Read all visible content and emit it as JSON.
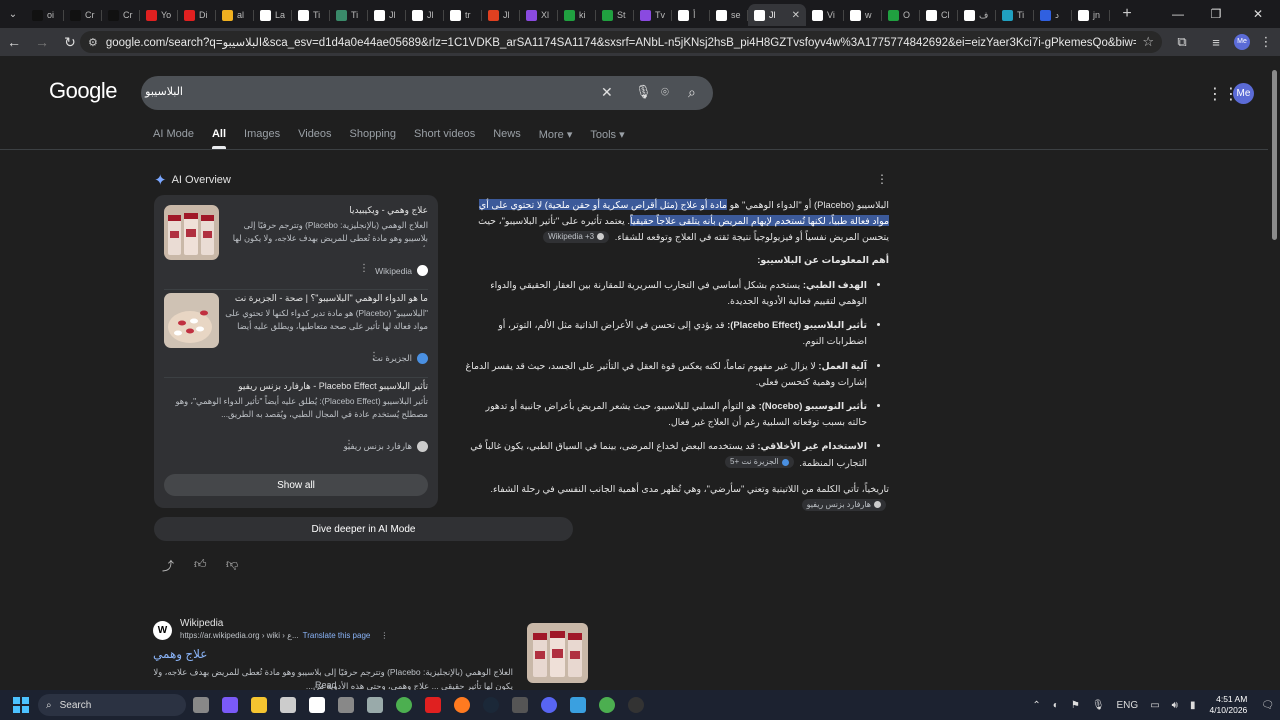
{
  "browser": {
    "tabs": [
      {
        "label": "oi",
        "color": "#111"
      },
      {
        "label": "Cr",
        "color": "#111"
      },
      {
        "label": "Cr",
        "color": "#111"
      },
      {
        "label": "Yo",
        "color": "#e02020"
      },
      {
        "label": "Di",
        "color": "#e02020"
      },
      {
        "label": "al",
        "color": "#f0b020"
      },
      {
        "label": "La",
        "color": "#ffffff"
      },
      {
        "label": "Ti",
        "color": "#ffffff"
      },
      {
        "label": "Ti",
        "color": "#3a8a6a"
      },
      {
        "label": "Jl",
        "color": "#ffffff"
      },
      {
        "label": "Jl",
        "color": "#ffffff"
      },
      {
        "label": "tr",
        "color": "#ffffff"
      },
      {
        "label": "Jl",
        "color": "#e04020"
      },
      {
        "label": "Xl",
        "color": "#8a4ae0"
      },
      {
        "label": "ki",
        "color": "#20a040"
      },
      {
        "label": "St",
        "color": "#20a040"
      },
      {
        "label": "Tv",
        "color": "#8a4ae0"
      },
      {
        "label": "أ",
        "color": "#ffffff"
      },
      {
        "label": "se",
        "color": "#ffffff"
      },
      {
        "label": "Jl",
        "color": "#ffffff",
        "active": true
      },
      {
        "label": "Vi",
        "color": "#ffffff"
      },
      {
        "label": "w",
        "color": "#ffffff"
      },
      {
        "label": "O",
        "color": "#20a040"
      },
      {
        "label": "Cl",
        "color": "#ffffff"
      },
      {
        "label": "ف",
        "color": "#ffffff"
      },
      {
        "label": "Ti",
        "color": "#20a0c0"
      },
      {
        "label": "د",
        "color": "#3060e0"
      },
      {
        "label": "jn",
        "color": "#ffffff"
      }
    ],
    "tab_close": "✕",
    "new_tab": "+",
    "url": "google.com/search?q=البلاسيبو&sca_esv=d1d4a0e44ae05689&rlz=1C1VDKB_arSA1174SA1174&sxsrf=ANbL-n5jKNsj2hsB_pi4H8GZTvsfoyv4w%3A1775774842692&ei=eizYaer3Kci7i-gPkemesQo&biw=1920&bih=945&oq=البلاسيب&gs_lp=Egwnd3Mt..."
  },
  "google": {
    "logo": "Google",
    "query": "البلاسيبو",
    "tabs": [
      "AI Mode",
      "All",
      "Images",
      "Videos",
      "Shopping",
      "Short videos",
      "News",
      "More ▾",
      "Tools ▾"
    ],
    "selected_tab": "All",
    "avatar": "Me"
  },
  "ai_overview": {
    "title": "AI Overview",
    "sources": [
      {
        "title": "علاج وهمي - ويكيبيديا",
        "snippet": "العلاج الوهمي (بالإنجليزية: Placebo) وتترجم حرفيًا إلى بلاسيبو وهو مادة تُعطى للمريض بهدف علاجه، ولا يكون لها تأثير حقيقي ف...",
        "site": "Wikipedia",
        "fav_color": "#ffffff"
      },
      {
        "title": "ما هو الدواء الوهمي \"البلاسيبو\"؟ | صحة - الجزيرة نت",
        "snippet": "\"البلاسيبو\" (Placebo) هو مادة تدير كدواء لكنها لا تحتوي على مواد فعالة لها تأثير على صحة متعاطيها، ويطلق عليه أيضا اسم...",
        "site": "الجزيرة نت",
        "fav_color": "#4a90e2"
      },
      {
        "title": "تأثير البلاسيبو Placebo Effect - هارفارد بزنس ريفيو",
        "snippet": "تأثير البلاسيبو (Placebo Effect): يُطلق عليه أيضاً \"تأثير الدواء الوهمي\"، وهو مصطلح يُستخدم عادة في المجال الطبي، ويُقصد به الطريق...",
        "site": "هارفارد بزنس ريفيو",
        "fav_color": "#cccccc"
      }
    ],
    "show_all": "Show all",
    "para1_a": "البلاسيبو (Placebo) أو \"الدواء الوهمي\" هو ",
    "para1_hl": "مادة أو علاج (مثل أقراص سكرية أو حقن ملحية) لا تحتوي على أي مواد فعالة طبياً، لكنها تُستخدم لإيهام المريض بأنه يتلقى علاجاً حقيقياً",
    "para1_b": ". يعتمد تأثيره على \"تأثير البلاسيبو\"، حيث يتحسن المريض نفسياً أو فيزيولوجياً نتيجة ثقته في العلاج وتوقعه للشفاء.",
    "para1_chip": "Wikipedia +3",
    "heading": "أهم المعلومات عن البلاسيبو:",
    "bullets": [
      {
        "bold": "الهدف الطبي:",
        "text": " يستخدم بشكل أساسي في التجارب السريرية للمقارنة بين العقار الحقيقي والدواء الوهمي لتقييم فعالية الأدوية الجديدة.",
        "chip": ""
      },
      {
        "bold": "تأثير البلاسيبو (Placebo Effect):",
        "text": " قد يؤدي إلى تحسن في الأعراض الذاتية مثل الألم، التوتر، أو اضطرابات النوم.",
        "chip": ""
      },
      {
        "bold": "آلية العمل:",
        "text": " لا يزال غير مفهوم تماماً، لكنه يعكس قوة العقل في التأثير على الجسد، حيث قد يفسر الدماغ إشارات وهمية كتحسن فعلي.",
        "chip": ""
      },
      {
        "bold": "تأثير النوسيبو (Nocebo):",
        "text": " هو التوأم السلبي للبلاسيبو، حيث يشعر المريض بأعراض جانبية أو تدهور حالته بسبب توقعاته السلبية رغم أن العلاج غير فعال.",
        "chip": ""
      },
      {
        "bold": "الاستخدام غير الأخلاقي:",
        "text": " قد يستخدمه البعض لخداع المرضى، بينما في السياق الطبي، يكون غالباً في التجارب المنظمة.",
        "chip": "الجزيرة نت +5"
      }
    ],
    "history": "تاريخياً، تأتي الكلمة من اللاتينية وتعني \"سأرضي\"، وهي تُظهر مدى أهمية الجانب النفسي في رحلة الشفاء.",
    "history_chip": "هارفارد بزنس ريفيو",
    "dive_deeper": "Dive deeper in AI Mode"
  },
  "result": {
    "site": "Wikipedia",
    "url": "https://ar.wikipedia.org › wiki › ع...",
    "translate": "Translate this page",
    "title": "علاج وهمي",
    "snippet": "العلاج الوهمي (بالإنجليزية: Placebo) وتترجم حرفيًا إلى بلاسيبو وهو مادة تُعطى للمريض بهدف علاجه، ولا يكون لها تأثير حقيقي ... علاج وهمي، وحتى هذه الأدوية من...",
    "read_more": "Read more"
  },
  "taskbar": {
    "search": "Search",
    "lang": "ENG",
    "time": "4:51 AM",
    "date": "4/10/2026"
  }
}
